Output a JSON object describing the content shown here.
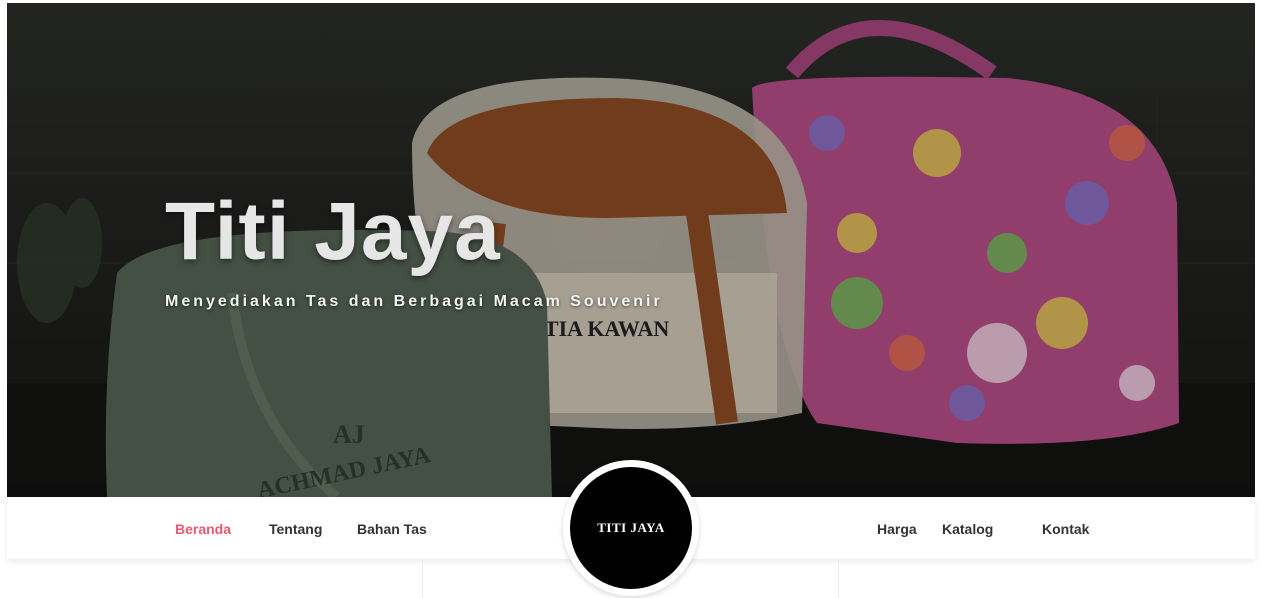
{
  "hero": {
    "title": "Titi Jaya",
    "subtitle": "Menyediakan Tas dan Berbagai Macam Souvenir",
    "bag_print": {
      "brand_left": "ACHMAD JAYA",
      "monogram": "AJ",
      "brand_center": "SETIA KAWAN"
    }
  },
  "nav": {
    "left": [
      {
        "label": "Beranda",
        "active": true
      },
      {
        "label": "Tentang",
        "active": false
      },
      {
        "label": "Bahan Tas",
        "active": false
      }
    ],
    "right": [
      {
        "label": "Harga",
        "active": false
      },
      {
        "label": "Katalog",
        "active": false
      },
      {
        "label": "Kontak",
        "active": false
      }
    ]
  },
  "logo": {
    "text": "TITI JAYA"
  },
  "colors": {
    "accent": "#e95a72",
    "nav_text": "#333333",
    "logo_bg": "#000000",
    "title": "#e6e6e6"
  }
}
